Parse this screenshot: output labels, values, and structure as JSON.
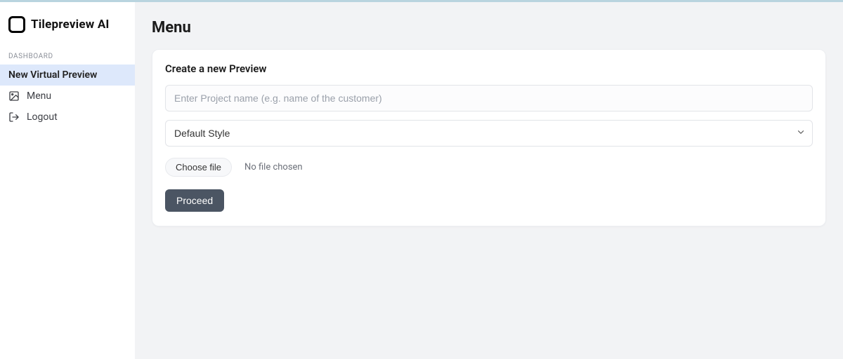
{
  "brand": {
    "name": "Tilepreview  AI"
  },
  "sidebar": {
    "section_label": "DASHBOARD",
    "items": [
      {
        "label": "New Virtual Preview"
      },
      {
        "label": "Menu"
      },
      {
        "label": "Logout"
      }
    ]
  },
  "page": {
    "title": "Menu"
  },
  "form": {
    "card_title": "Create a new Preview",
    "project_placeholder": "Enter Project name (e.g. name of the customer)",
    "project_value": "",
    "style_selected": "Default Style",
    "choose_file_label": "Choose file",
    "file_status": "No file chosen",
    "proceed_label": "Proceed"
  }
}
